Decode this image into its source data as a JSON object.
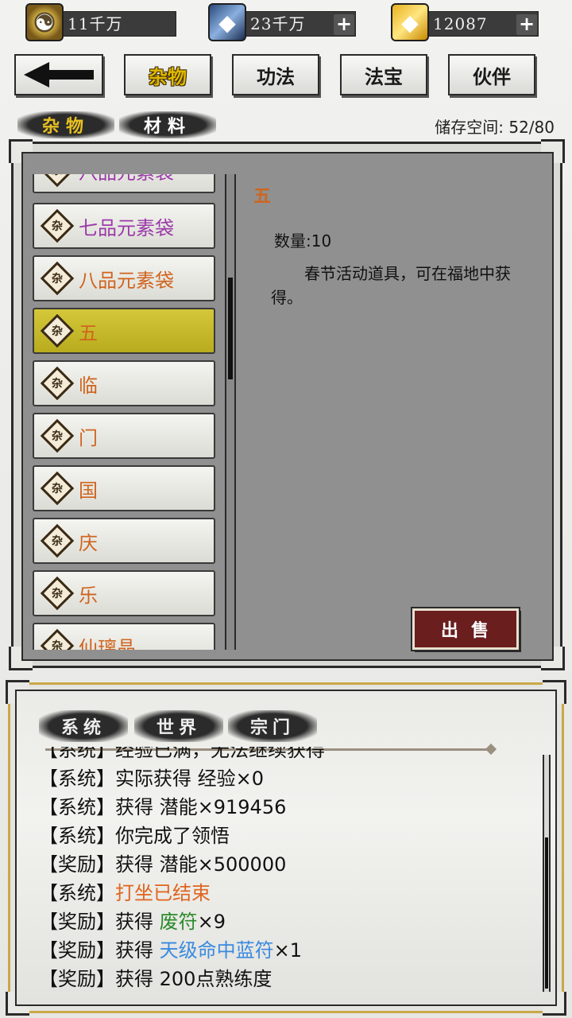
{
  "currencies": [
    {
      "id": "coin",
      "icon": "taiji-coin-icon",
      "value": "11千万"
    },
    {
      "id": "crystal",
      "icon": "blue-crystal-icon",
      "value": "23千万",
      "plus": "+"
    },
    {
      "id": "gold",
      "icon": "gold-ingot-icon",
      "value": "12087",
      "plus": "+"
    }
  ],
  "nav": {
    "back_icon": "arrow-left-icon",
    "tabs": [
      {
        "label": "杂物",
        "active": true
      },
      {
        "label": "功法"
      },
      {
        "label": "法宝"
      },
      {
        "label": "伙伴"
      }
    ]
  },
  "subtabs": [
    {
      "label": "杂物",
      "active": true
    },
    {
      "label": "材料"
    }
  ],
  "storage": "储存空间: 52/80",
  "items": [
    {
      "badge": "杂",
      "name": "八品元素袋",
      "color": "purple",
      "partial": true
    },
    {
      "badge": "杂",
      "name": "七品元素袋",
      "color": "purple"
    },
    {
      "badge": "杂",
      "name": "八品元素袋",
      "color": "orange"
    },
    {
      "badge": "杂",
      "name": "五",
      "color": "orange",
      "selected": true
    },
    {
      "badge": "杂",
      "name": "临",
      "color": "orange"
    },
    {
      "badge": "杂",
      "name": "门",
      "color": "orange"
    },
    {
      "badge": "杂",
      "name": "国",
      "color": "orange"
    },
    {
      "badge": "杂",
      "name": "庆",
      "color": "orange"
    },
    {
      "badge": "杂",
      "name": "乐",
      "color": "orange"
    },
    {
      "badge": "杂",
      "name": "仙璃晶",
      "color": "orange",
      "partial": true
    }
  ],
  "detail": {
    "title": "五",
    "quantity": "数量:10",
    "description": "春节活动道具，可在福地中获得。"
  },
  "sell_label": "出售",
  "chat": {
    "tabs": [
      "系统",
      "世界",
      "宗门"
    ],
    "messages": [
      {
        "tag": "【系统】",
        "parts": [
          {
            "text": "经验已满，无法继续获得"
          }
        ],
        "partial": true
      },
      {
        "tag": "【系统】",
        "parts": [
          {
            "text": "实际获得 经验×0"
          }
        ]
      },
      {
        "tag": "【系统】",
        "parts": [
          {
            "text": "获得 潜能×919456"
          }
        ]
      },
      {
        "tag": "【系统】",
        "parts": [
          {
            "text": "你完成了领悟"
          }
        ]
      },
      {
        "tag": "【奖励】",
        "parts": [
          {
            "text": "获得 潜能×500000"
          }
        ]
      },
      {
        "tag": "【系统】",
        "parts": [
          {
            "text": "打坐已结束",
            "color": "orange"
          }
        ]
      },
      {
        "tag": "【奖励】",
        "parts": [
          {
            "text": "获得 "
          },
          {
            "text": "废符",
            "color": "green"
          },
          {
            "text": "×9"
          }
        ]
      },
      {
        "tag": "【奖励】",
        "parts": [
          {
            "text": "获得 "
          },
          {
            "text": "天级命中蓝符",
            "color": "blue"
          },
          {
            "text": "×1"
          }
        ]
      },
      {
        "tag": "【奖励】",
        "parts": [
          {
            "text": "获得 200点熟练度"
          }
        ]
      }
    ]
  }
}
